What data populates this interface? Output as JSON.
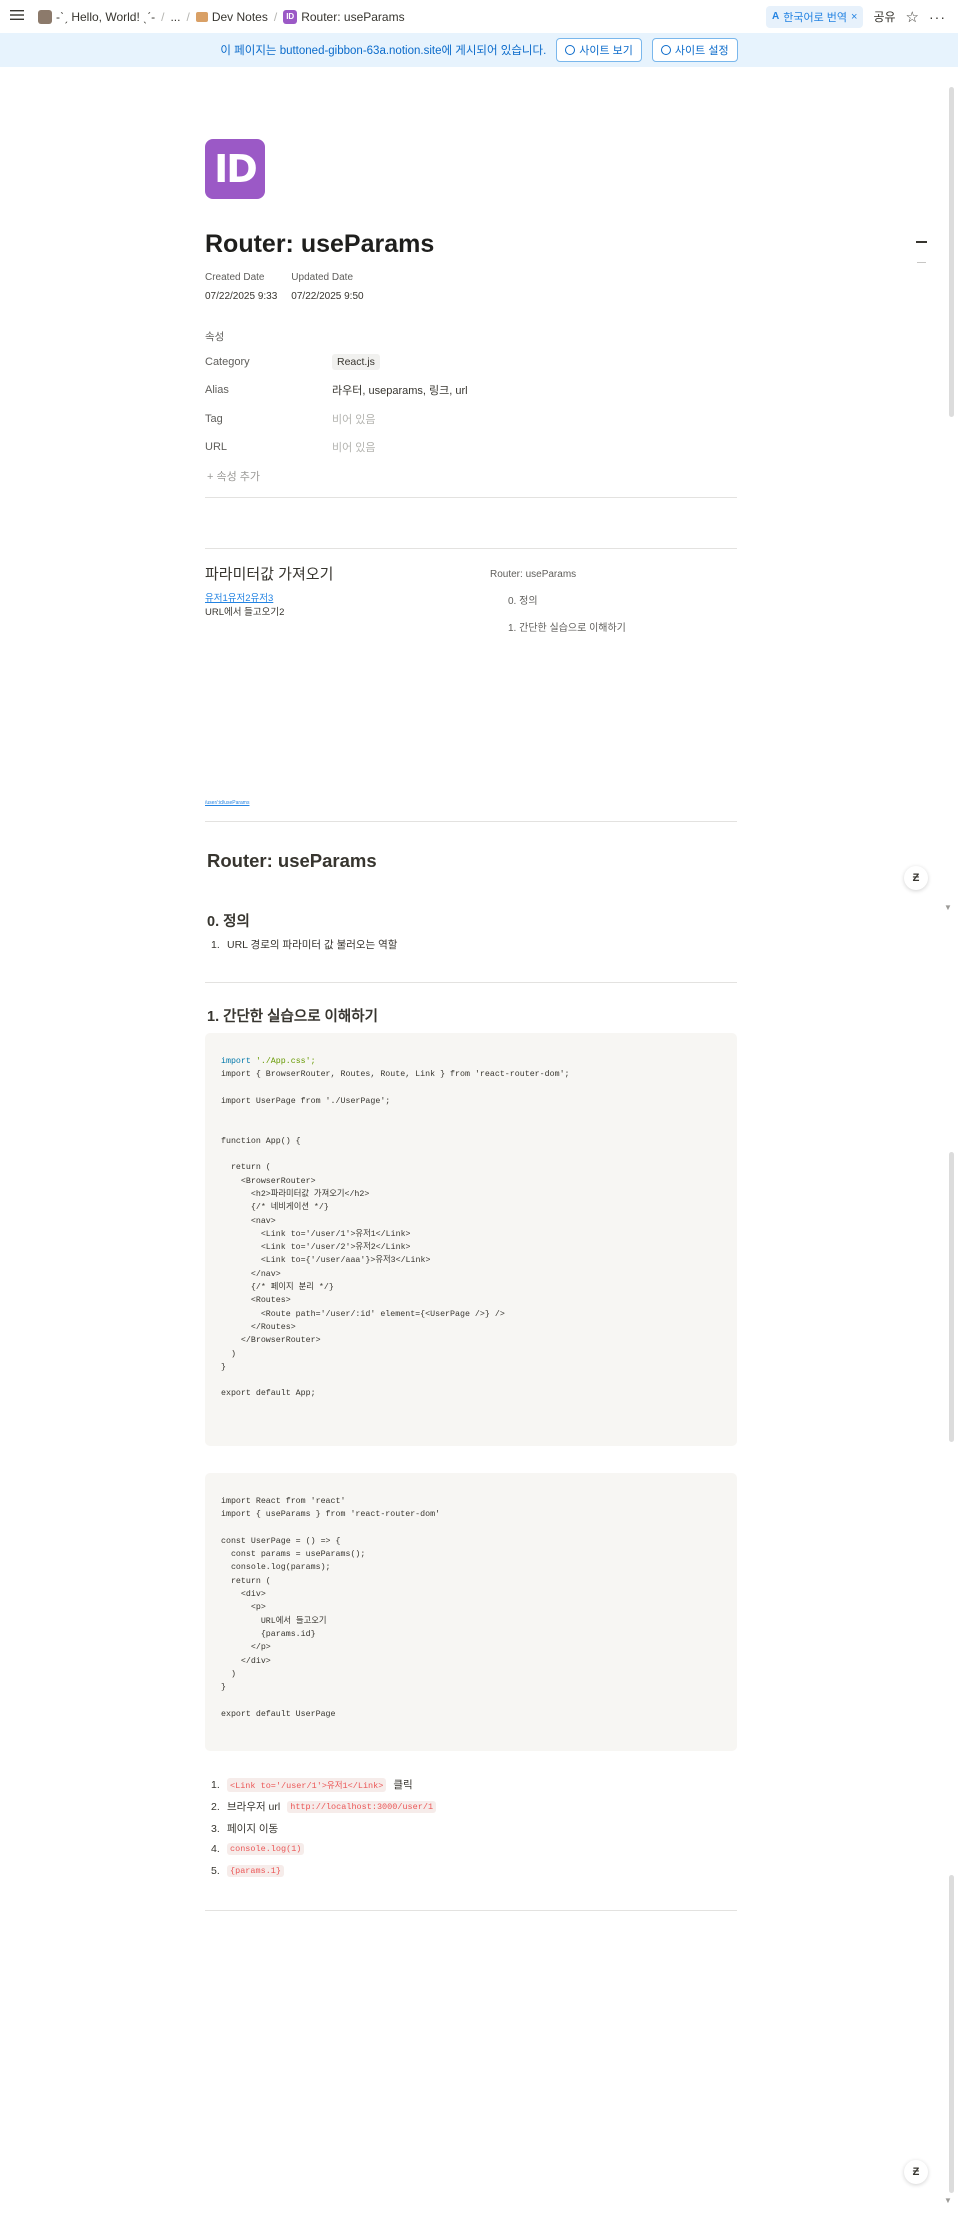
{
  "topbar": {
    "breadcrumbs": [
      "-ˋˏ Hello, World! ˎˊ-",
      "...",
      "Dev Notes",
      "Router: useParams"
    ],
    "translate_label": "한국어로 번역",
    "share_label": "공유"
  },
  "banner": {
    "text": "이 페이지는 buttoned-gibbon-63a.notion.site에 게시되어 있습니다.",
    "view_site": "사이트 보기",
    "site_settings": "사이트 설정"
  },
  "page": {
    "icon_text": "ID",
    "title": "Router: useParams",
    "created_label": "Created Date",
    "created_value": "07/22/2025 9:33",
    "updated_label": "Updated Date",
    "updated_value": "07/22/2025 9:50",
    "properties_heading": "속성",
    "properties": [
      {
        "key": "Category",
        "value": "React.js"
      },
      {
        "key": "Alias",
        "value": "라우터, useparams, 링크, url"
      },
      {
        "key": "Tag",
        "value": "비어 있음"
      },
      {
        "key": "URL",
        "value": "비어 있음"
      }
    ],
    "add_property": "속성 추가"
  },
  "synced": {
    "heading": "파라미터값 가져오기",
    "links": "유저1유저2유저3",
    "text": "URL에서 들고오기2",
    "toc": [
      "Router: useParams",
      "0. 정의",
      "1. 간단한 실습으로 이해하기"
    ],
    "tiny_link": "/user/:id/useParams"
  },
  "content": {
    "h1": "Router: useParams",
    "h2_def": "0. 정의",
    "def_items": [
      "URL 경로의 파라미터 값 불러오는 역할"
    ],
    "h2_practice": "1. 간단한 실습으로 이해하기",
    "steps": [
      {
        "num": "1.",
        "code": "<Link to='/user/1'>유저1</Link>",
        "text": "클릭"
      },
      {
        "num": "2.",
        "text": "브라우저 url",
        "code": "http://localhost:3000/user/1"
      },
      {
        "num": "3.",
        "text": "페이지 이동"
      },
      {
        "num": "4.",
        "code": "console.log(1)"
      },
      {
        "num": "5.",
        "code": "{params.1}"
      }
    ]
  },
  "code_blocks": {
    "app": [
      "import './App.css';",
      "import { BrowserRouter, Routes, Route, Link } from 'react-router-dom';",
      "",
      "import UserPage from './UserPage';",
      "",
      "",
      "function App() {",
      "",
      "  return (",
      "    <BrowserRouter>",
      "      <h2>파라미터값 가져오기</h2>",
      "      {/* 네비게이션 */}",
      "      <nav>",
      "        <Link to='/user/1'>유저1</Link>",
      "        <Link to='/user/2'>유저2</Link>",
      "        <Link to={'/user/aaa'}>유저3</Link>",
      "      </nav>",
      "      {/* 페이지 분리 */}",
      "      <Routes>",
      "        <Route path='/user/:id' element={<UserPage />} />",
      "      </Routes>",
      "    </BrowserRouter>",
      "  )",
      "}",
      "",
      "export default App;"
    ],
    "userpage": [
      "import React from 'react'",
      "import { useParams } from 'react-router-dom'",
      "",
      "const UserPage = () => {",
      "  const params = useParams();",
      "  console.log(params);",
      "  return (",
      "    <div>",
      "      <p>",
      "        URL에서 들고오기",
      "        {params.id}",
      "      </p>",
      "    </div>",
      "  )",
      "}",
      "",
      "export default UserPage"
    ]
  },
  "icons": [
    "menu-icon",
    "translate-icon",
    "star-icon",
    "more-icon",
    "globe-icon",
    "settings-icon",
    "plus-icon"
  ]
}
